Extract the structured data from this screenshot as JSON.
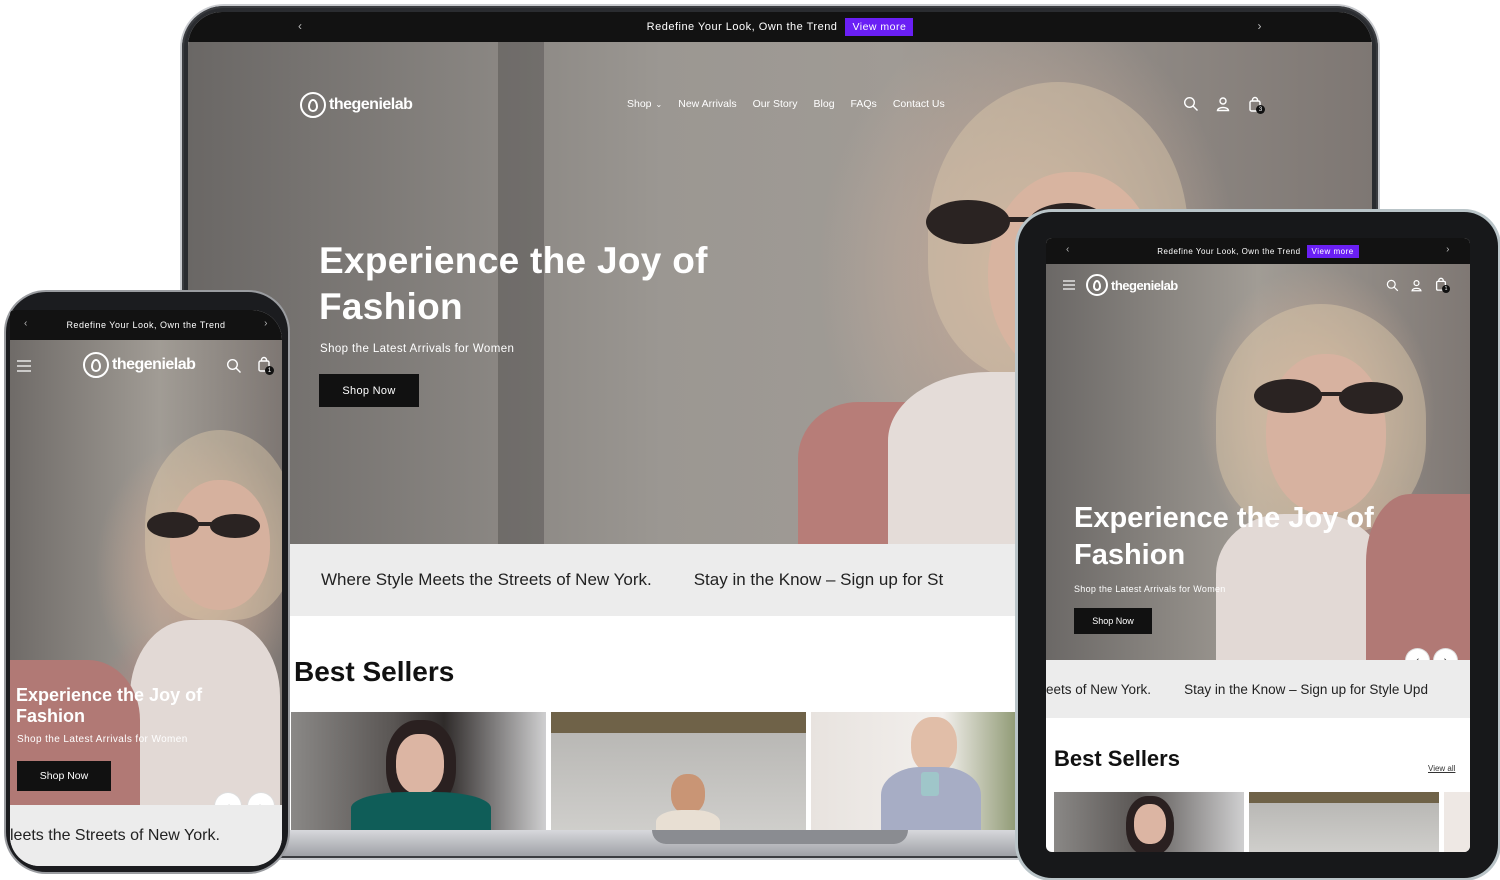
{
  "announcement": {
    "text": "Redefine Your Look, Own the Trend",
    "cta": "View more",
    "prev": "‹",
    "next": "›",
    "accent_color": "#6a1ff5"
  },
  "brand": {
    "name": "thegenielab"
  },
  "nav": {
    "items": [
      "Shop",
      "New Arrivals",
      "Our Story",
      "Blog",
      "FAQs",
      "Contact Us"
    ],
    "cart_count": "3"
  },
  "hero": {
    "title": "Experience the Joy of Fashion",
    "subtitle": "Shop the Latest Arrivals for Women",
    "cta": "Shop Now",
    "slides": 3,
    "active_slide": 1
  },
  "marquee": {
    "items": [
      "Where Style Meets the Streets of New York.",
      "Stay in the Know – Sign up for St"
    ]
  },
  "best_sellers": {
    "title": "Best Sellers",
    "view_all": "View all"
  },
  "phone": {
    "cart_count": "1",
    "marquee_text": "leets the Streets of New York."
  },
  "tablet": {
    "cart_count": "1",
    "marquee_left": "eets of New York.",
    "marquee_right": "Stay in the Know – Sign up for Style Upd"
  }
}
